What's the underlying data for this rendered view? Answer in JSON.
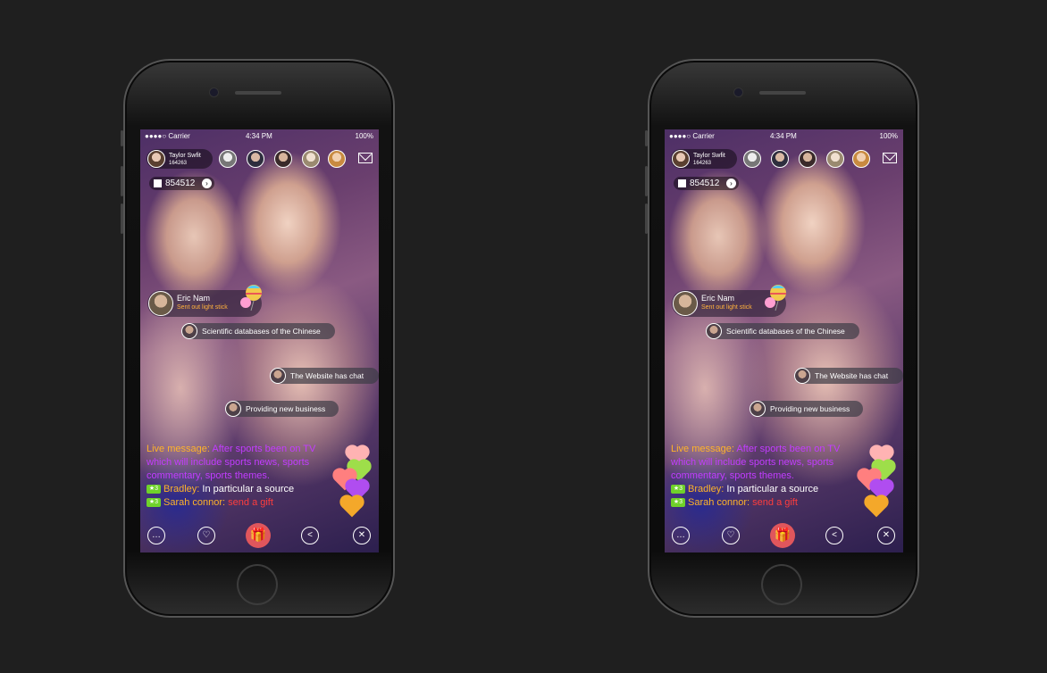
{
  "status": {
    "carrier": "●●●●○ Carrier",
    "time": "4:34 PM",
    "battery": "100%"
  },
  "host": {
    "name": "Taylor Swfit",
    "id": "164263"
  },
  "coins": {
    "value": "854512",
    "arrow": "›"
  },
  "gift_notice": {
    "name": "Eric Nam",
    "subtitle": "Sent out light stick"
  },
  "bubbles": [
    "Scientific databases of the Chinese",
    "The Website has chat",
    "Providing new business"
  ],
  "chat": {
    "live_label": "Live message:",
    "live_text": " After sports been on TV which will include sports news, sports commentary, sports themes.",
    "level_badge": "★3",
    "row1_user": "Bradley:",
    "row1_msg": " In particular a source",
    "row2_user": "Sarah connor:",
    "row2_msg": "  send a gift"
  },
  "icons": {
    "comment": "…",
    "heart": "♡",
    "gift": "🎁",
    "share": "<",
    "close": "✕",
    "mail": "mail-icon"
  },
  "colors": {
    "accent_orange": "#ffb329",
    "live_purple": "#c23cff",
    "gift_red": "#e0565c",
    "level_green": "#6fd12a"
  }
}
